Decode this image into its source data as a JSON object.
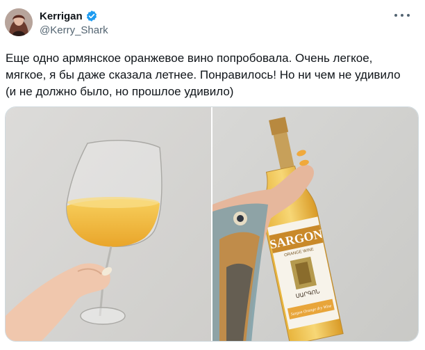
{
  "author": {
    "display_name": "Kerrigan",
    "handle": "@Kerry_Shark",
    "verified_icon": "verified-badge-icon",
    "avatar_icon": "avatar"
  },
  "tweet": {
    "lines": [
      "Еще одно армянское оранжевое вино попробовала. Очень легкое,",
      "мягкое, я бы даже сказала летнее. Понравилось! Но ни чем не удивило",
      "(и не должно было, но прошлое удивило)"
    ]
  },
  "media": {
    "bottle_brand": "SARGON",
    "bottle_subtitle": "ORANGE WINE",
    "bottle_label_armenian": "ՍԱՐԳՈՆ",
    "bottle_bottom_label": "Sargon Orange dry Wine"
  },
  "colors": {
    "accent": "#1d9bf0",
    "text_primary": "#0f1419",
    "text_secondary": "#536471",
    "wine": "#f2b23a"
  }
}
